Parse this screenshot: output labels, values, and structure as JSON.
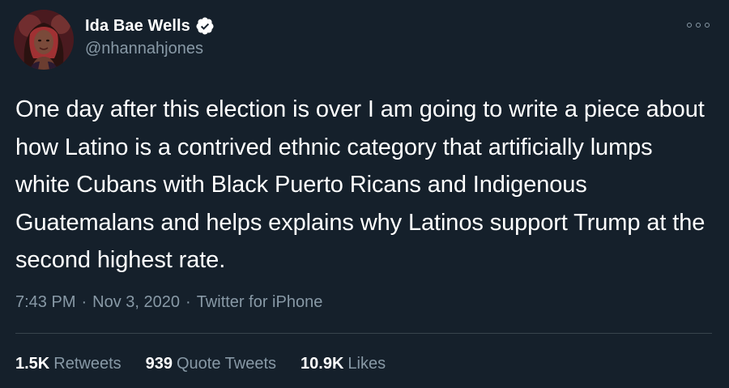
{
  "author": {
    "display_name": "Ida Bae Wells",
    "handle": "@nhannahjones",
    "verified_icon": "verified-badge-icon",
    "avatar_icon": "avatar"
  },
  "tweet": {
    "text": "One day after this election is over I am going to write a piece about how Latino is a contrived ethnic category that artificially lumps white Cubans with Black Puerto Ricans and Indigenous Guatemalans and helps explains why Latinos support Trump at the second highest rate.",
    "time": "7:43 PM",
    "date": "Nov 3, 2020",
    "source": "Twitter for iPhone",
    "separator": "·"
  },
  "stats": {
    "retweets_count": "1.5K",
    "retweets_label": "Retweets",
    "quotes_count": "939",
    "quotes_label": "Quote Tweets",
    "likes_count": "10.9K",
    "likes_label": "Likes"
  },
  "colors": {
    "background": "#15202b",
    "text_primary": "#ffffff",
    "text_secondary": "#8899a6",
    "divider": "#38444d"
  }
}
